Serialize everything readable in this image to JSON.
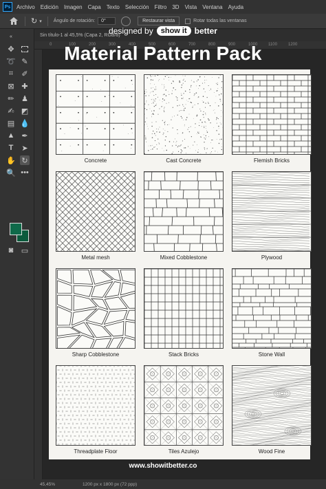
{
  "app": {
    "logo": "Ps"
  },
  "menu": [
    "Archivo",
    "Edición",
    "Imagen",
    "Capa",
    "Texto",
    "Selección",
    "Filtro",
    "3D",
    "Vista",
    "Ventana",
    "Ayuda"
  ],
  "options": {
    "rotation_label": "Ángulo de rotación:",
    "rotation_value": "0°",
    "reset_button": "Restaurar vista",
    "rotate_all": "Rotar todas las ventanas"
  },
  "document": {
    "tab": "Sin título-1 al 45,5% (Capa 2, RGB/8)"
  },
  "ruler": [
    "0",
    "100",
    "200",
    "300",
    "400",
    "500",
    "600",
    "700",
    "800",
    "900",
    "1000",
    "1100",
    "1200"
  ],
  "status": {
    "zoom": "45,45%",
    "dimensions": "1200 px x 1800 px (72 ppp)"
  },
  "overlay": {
    "designed_by": "designed by",
    "brand_pill": "show it",
    "brand_tail": "better",
    "title": "Material Pattern Pack",
    "website": "www.showitbetter.co"
  },
  "patterns": [
    {
      "label": "Concrete",
      "kind": "concrete"
    },
    {
      "label": "Cast Concrete",
      "kind": "cast"
    },
    {
      "label": "Flemish Bricks",
      "kind": "flemish"
    },
    {
      "label": "Metal mesh",
      "kind": "mesh"
    },
    {
      "label": "Mixed Cobblestone",
      "kind": "mixedcobble"
    },
    {
      "label": "Plywood",
      "kind": "plywood"
    },
    {
      "label": "Sharp Cobblestone",
      "kind": "sharpcobble"
    },
    {
      "label": "Stack Bricks",
      "kind": "stack"
    },
    {
      "label": "Stone Wall",
      "kind": "stonewall"
    },
    {
      "label": "Threadplate Floor",
      "kind": "thread"
    },
    {
      "label": "Tiles Azulejo",
      "kind": "azulejo"
    },
    {
      "label": "Wood Fine",
      "kind": "woodfine"
    }
  ],
  "colors": {
    "foreground": "#0f6a4a",
    "background": "#0b5a3c",
    "sheet": "#f5f4f0"
  }
}
